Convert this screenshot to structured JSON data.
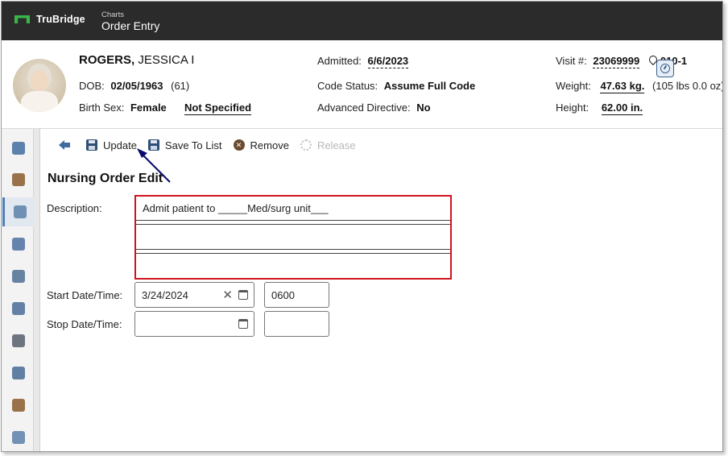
{
  "app": {
    "brand": "TruBridge",
    "crumb": "Charts",
    "title": "Order Entry"
  },
  "patient": {
    "last_name": "ROGERS,",
    "first_name": "JESSICA I",
    "dob_label": "DOB:",
    "dob": "02/05/1963",
    "age": "(61)",
    "sex_label": "Birth Sex:",
    "sex": "Female",
    "gender": "Not Specified",
    "admitted_label": "Admitted:",
    "admitted": "6/6/2023",
    "code_label": "Code Status:",
    "code": "Assume Full Code",
    "directive_label": "Advanced Directive:",
    "directive": "No",
    "visit_label": "Visit #:",
    "visit": "23069999",
    "location": "010-1",
    "weight_label": "Weight:",
    "weight": "47.63 kg.",
    "weight_alt": "(105 lbs 0.0 oz)",
    "height_label": "Height:",
    "height": "62.00 in."
  },
  "sidebar": {
    "items": [
      {
        "icon": "chart-icon",
        "color": "#3f6c9f"
      },
      {
        "icon": "clock-icon",
        "color": "#8a5a2b"
      },
      {
        "icon": "nurse-icon",
        "color": "#5b7fa8"
      },
      {
        "icon": "meds-icon",
        "color": "#4b6fa0"
      },
      {
        "icon": "pharmacy-icon",
        "color": "#4f6f93"
      },
      {
        "icon": "documents-icon",
        "color": "#4a6c96"
      },
      {
        "icon": "device-icon",
        "color": "#555e6a"
      },
      {
        "icon": "database-icon",
        "color": "#476a94"
      },
      {
        "icon": "person-icon",
        "color": "#8a5a2b"
      },
      {
        "icon": "provider-icon",
        "color": "#5b7fa8"
      }
    ],
    "active_index": 2
  },
  "toolbar": {
    "update": "Update",
    "save_to_list": "Save To List",
    "remove": "Remove",
    "release": "Release"
  },
  "form": {
    "title": "Nursing Order Edit",
    "description_label": "Description:",
    "description_lines": [
      "Admit patient to _____Med/surg unit___",
      "",
      ""
    ],
    "start_label": "Start Date/Time:",
    "start_date": "3/24/2024",
    "start_time": "0600",
    "stop_label": "Stop Date/Time:",
    "stop_date": "",
    "stop_time": ""
  },
  "colors": {
    "topbar": "#2b2b2b",
    "brand_green": "#39b54a",
    "highlight_red": "#d0141e",
    "annotation_arrow": "#0a0a6e"
  }
}
